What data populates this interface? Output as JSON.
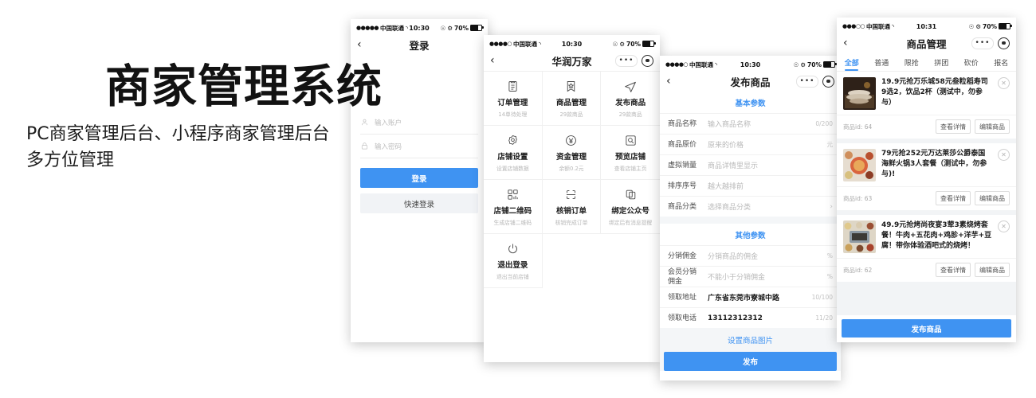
{
  "promo": {
    "title": "商家管理系统",
    "subtitle": "PC商家管理后台、小程序商家管理后台\n多方位管理"
  },
  "status_bar": {
    "carrier": "中国联通",
    "dots": "●●●●●",
    "dots_partial": "●●●●○",
    "dots_partial2": "●●●○○",
    "wifi_icon": "wifi-icon",
    "time_1030": "10:30",
    "time_1031": "10:31",
    "battery_pct": "70%",
    "alarm_icon": "alarm-icon",
    "bluetooth_icon": "bluetooth-icon"
  },
  "nav_caps": {
    "more_label": "•••",
    "circle_icon": "target-circle-icon",
    "back_icon": "chevron-left-icon"
  },
  "phone_login": {
    "title": "登录",
    "account": {
      "icon": "user-icon",
      "placeholder": "输入账户",
      "value": ""
    },
    "password": {
      "icon": "lock-icon",
      "placeholder": "输入密码",
      "value": ""
    },
    "login_button": "登录",
    "quick_login_button": "快速登录"
  },
  "phone_grid": {
    "title": "华润万家",
    "cells": [
      {
        "icon": "clipboard-icon",
        "label": "订单管理",
        "sub": "14单待处理"
      },
      {
        "icon": "bookmark-star-icon",
        "label": "商品管理",
        "sub": "29款商品"
      },
      {
        "icon": "paper-plane-icon",
        "label": "发布商品",
        "sub": "29款商品"
      },
      {
        "icon": "gear-icon",
        "label": "店铺设置",
        "sub": "设置店铺数据"
      },
      {
        "icon": "yuan-circle-icon",
        "label": "资金管理",
        "sub": "余额0.2元"
      },
      {
        "icon": "search-box-icon",
        "label": "预览店铺",
        "sub": "查看店铺主页"
      },
      {
        "icon": "qrcode-icon",
        "label": "店铺二维码",
        "sub": "生成店铺二维码"
      },
      {
        "icon": "scan-icon",
        "label": "核销订单",
        "sub": "核销完成订单"
      },
      {
        "icon": "copy-icon",
        "label": "绑定公众号",
        "sub": "绑定后有消息提醒"
      },
      {
        "icon": "power-icon",
        "label": "退出登录",
        "sub": "退出当前店铺"
      }
    ]
  },
  "phone_form": {
    "title": "发布商品",
    "section_basic": "基本参数",
    "section_other": "其他参数",
    "basic_rows": [
      {
        "label": "商品名称",
        "value": "输入商品名称",
        "filled": false,
        "unit": "0/200"
      },
      {
        "label": "商品原价",
        "value": "原来的价格",
        "filled": false,
        "unit": "元"
      },
      {
        "label": "虚拟销量",
        "value": "商品详情里显示",
        "filled": false,
        "unit": ""
      },
      {
        "label": "排序序号",
        "value": "越大越排前",
        "filled": false,
        "unit": ""
      },
      {
        "label": "商品分类",
        "value": "选择商品分类",
        "filled": false,
        "unit": "",
        "chevron": "›"
      }
    ],
    "other_rows": [
      {
        "label": "分销佣金",
        "value": "分销商品的佣金",
        "filled": false,
        "unit": "%"
      },
      {
        "label": "会员分销\n佣金",
        "value": "不能小于分销佣金",
        "filled": false,
        "unit": "%"
      },
      {
        "label": "领取地址",
        "value": "广东省东莞市寮城中路",
        "filled": true,
        "unit": "10/100"
      },
      {
        "label": "领取电话",
        "value": "13112312312",
        "filled": true,
        "unit": "11/20"
      }
    ],
    "image_link": "设置商品图片",
    "publish_button": "发布"
  },
  "phone_goods": {
    "title": "商品管理",
    "tabs": [
      "全部",
      "普通",
      "限抢",
      "拼团",
      "砍价",
      "报名"
    ],
    "active_tab": "全部",
    "id_prefix": "商品id:",
    "detail_button": "查看详情",
    "edit_button": "编辑商品",
    "close_icon": "close-circle-icon",
    "publish_button": "发布商品",
    "items": [
      {
        "name": "19.9元抢万乐城58元叁粒稻寿司9选2，饮品2杯（测试中，勿参与）",
        "id": "64",
        "thumb_colors": [
          "#3b2b1f",
          "#6b4a2c",
          "#d9c6ad"
        ]
      },
      {
        "name": "79元抢252元万达莱莎公爵泰国海鲜火锅3人套餐（测试中，勿参与)!",
        "id": "63",
        "thumb_colors": [
          "#c9604a",
          "#e8b06a",
          "#8a3b2a"
        ]
      },
      {
        "name": "49.9元抢烤尚夜宴3荤3素烧烤套餐！牛肉+五花肉+鸡胗+洋芋+豆腐！带你体验酒吧式的烧烤！",
        "id": "62",
        "thumb_colors": [
          "#9aa7b0",
          "#d8b87a",
          "#6e4a34"
        ]
      }
    ]
  },
  "colors": {
    "accent": "#3f93f2",
    "text": "#1a1a1a",
    "muted": "#b9b9b9",
    "bg": "#ffffff",
    "panel": "#f4f6f8"
  }
}
